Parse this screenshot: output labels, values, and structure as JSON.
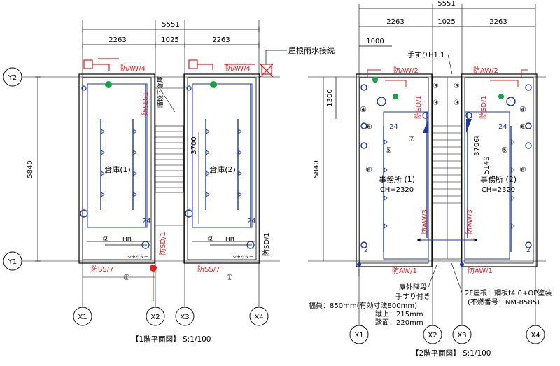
{
  "floor1": {
    "dims": {
      "total": "5551",
      "left": "2263",
      "mid": "1025",
      "right": "2263",
      "height": "5840",
      "stair_len": "3700"
    },
    "grid": {
      "x1": "X1",
      "x2": "X2",
      "x3": "X3",
      "x4": "X4",
      "y1": "Y1",
      "y2": "Y2"
    },
    "room_left": "倉庫(1)",
    "room_right": "倉庫(2)",
    "stair_note": "階段下倉庫",
    "roof_rain": "屋根雨水接続",
    "wall_top_left": "防AW/4",
    "wall_top_right": "防AW/4",
    "wall_sd_upper": "防SD/1",
    "wall_sd_mid": "防SD/1",
    "wall_sd_right": "防SD/1",
    "wall_ss_left": "防SS/7",
    "wall_ss_right": "防SS/7",
    "shutter_left": "シャッター",
    "shutter_right": "シャッター",
    "hb_left": "HB",
    "hb_right": "HB",
    "n24_left": "24",
    "n24_right": "24",
    "c2_left": "②",
    "c2_right": "②",
    "c1": "①",
    "caption": "【1階平面図】 S:1/100"
  },
  "floor2": {
    "dims": {
      "total": "5551",
      "left": "2263",
      "mid": "1025",
      "right": "2263",
      "sub": "1000",
      "h1300": "1300",
      "height": "5840",
      "stair_len": "3700",
      "h5149": "5149"
    },
    "grid": {
      "x1": "X1",
      "x2": "X2",
      "x3": "X3",
      "x4": "X4"
    },
    "handrail": "手すりH1.1",
    "room_left": "事務所 (1)",
    "room_left_ch": "CH=2320",
    "room_right": "事務所 (2)",
    "room_right_ch": "CH=2320",
    "wall_top_left": "防AW/2",
    "wall_top_right": "防AW/2",
    "wall_sd_left": "防SD/1",
    "wall_sd_right": "防SD/1",
    "wall_aw3_left": "防AW/3",
    "wall_aw3_right": "防AW/3",
    "wall_bot_left": "防AW/1",
    "wall_bot_right": "防AW/1",
    "n24_left": "24",
    "n24_right": "24",
    "c2_left": "2",
    "c2_right": "2",
    "c3": "③",
    "c4": "④",
    "c5": "⑤",
    "c6": "⑥",
    "c7": "⑦",
    "c8": "⑧",
    "ext_stair": "屋外階段",
    "ext_rail": "手すり付き",
    "width": "幅員：850mm(有効寸法800mm)",
    "riser": "蹴上：215mm",
    "tread": "踏面：220mm",
    "roof_note": "2F屋根：鋼板t4.0+OP塗装",
    "roof_no": "(不燃番号：NM-8585)",
    "caption": "【2階平面図】 S:1/100"
  }
}
